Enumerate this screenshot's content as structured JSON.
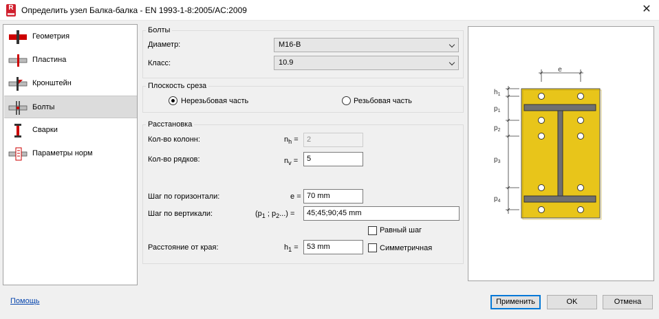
{
  "window": {
    "title": "Определить узел Балка-балка - EN 1993-1-8:2005/AC:2009",
    "app_icon_letter": "R"
  },
  "sidebar": {
    "items": [
      {
        "label": "Геометрия",
        "icon": "beam-geometry-icon"
      },
      {
        "label": "Пластина",
        "icon": "plate-icon"
      },
      {
        "label": "Кронштейн",
        "icon": "bracket-icon"
      },
      {
        "label": "Болты",
        "icon": "bolts-icon",
        "selected": true
      },
      {
        "label": "Сварки",
        "icon": "welds-icon"
      },
      {
        "label": "Параметры норм",
        "icon": "code-parameters-icon"
      }
    ]
  },
  "bolts_group": {
    "title": "Болты",
    "diameter_label": "Диаметр:",
    "diameter_value": "M16-B",
    "class_label": "Класс:",
    "class_value": "10.9"
  },
  "shear_group": {
    "title": "Плоскость среза",
    "option_unthreaded": "Нерезьбовая часть",
    "option_threaded": "Резьбовая часть",
    "selected": "unthreaded"
  },
  "layout_group": {
    "title": "Расстановка",
    "columns_label": "Кол-во колонн:",
    "columns_symbol": "n",
    "columns_sub": "h",
    "columns_value": "2",
    "rows_label": "Кол-во рядков:",
    "rows_symbol": "n",
    "rows_sub": "v",
    "rows_value": "5",
    "hstep_label": "Шаг по горизонтали:",
    "hstep_symbol": "e",
    "hstep_value": "70 mm",
    "vstep_label": "Шаг по вертикали:",
    "vstep_symbol_1": "(p",
    "vstep_sub_1": "1",
    "vstep_symbol_2": "; p",
    "vstep_sub_2": "2",
    "vstep_symbol_3": "...)",
    "vstep_value": "45;45;90;45 mm",
    "equal_step_label": "Равный шаг",
    "edge_label": "Расстояние от края:",
    "edge_symbol": "h",
    "edge_sub": "1",
    "edge_value": "53 mm",
    "symmetric_label": "Симметричная",
    "equals": "="
  },
  "preview": {
    "dim_e": "e",
    "dim_h1": "h",
    "dim_h1_sub": "1",
    "dim_p1": "p",
    "dim_p1_sub": "1",
    "dim_p2": "p",
    "dim_p2_sub": "2",
    "dim_p3": "p",
    "dim_p3_sub": "3",
    "dim_p4": "p",
    "dim_p4_sub": "4",
    "plate_color": "#e8c51a",
    "beam_color": "#6e6e6e"
  },
  "footer": {
    "help_label": "Помощь",
    "apply_label": "Применить",
    "ok_label": "OK",
    "cancel_label": "Отмена"
  }
}
